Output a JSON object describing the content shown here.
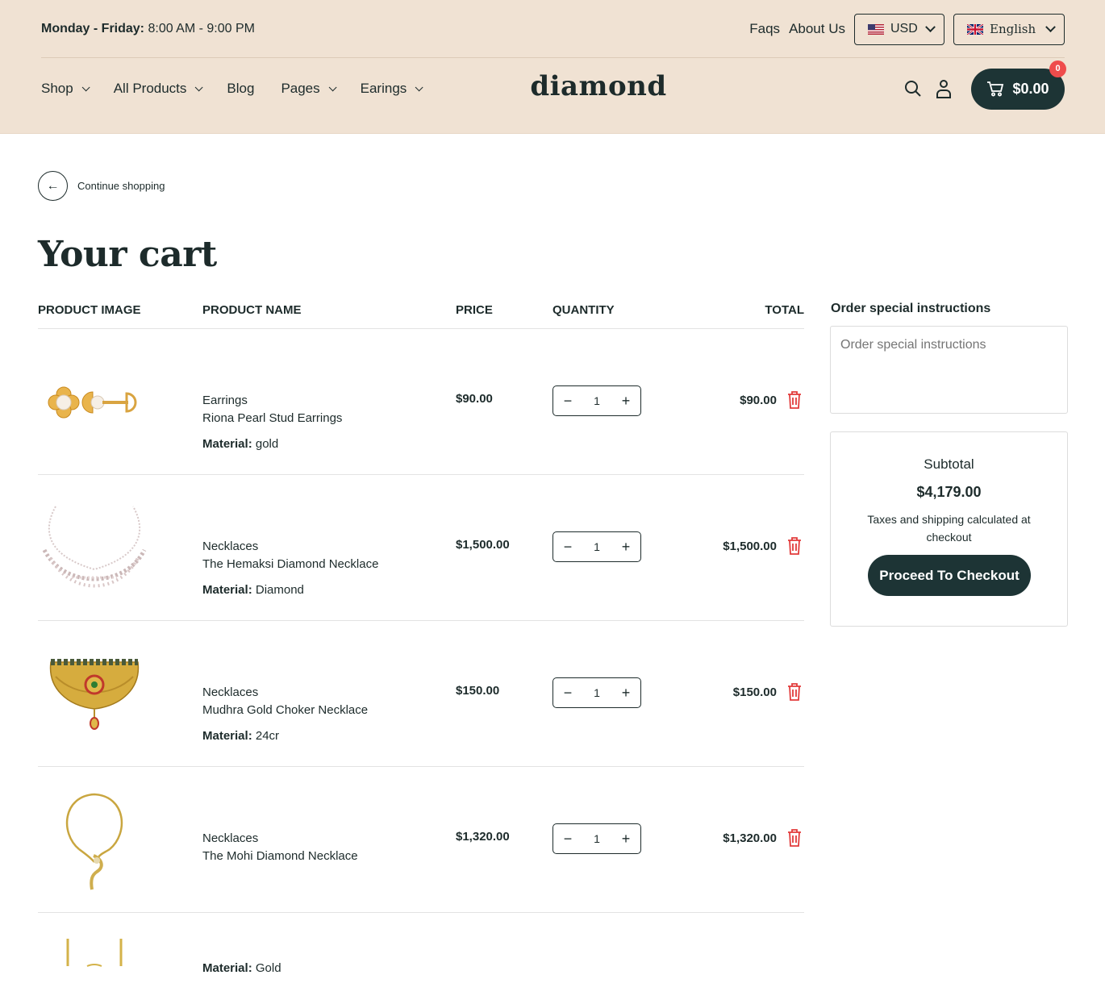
{
  "header": {
    "hours_label": "Monday - Friday:",
    "hours_value": "8:00 AM - 9:00 PM",
    "links": {
      "faqs": "Faqs",
      "about": "About Us"
    },
    "currency": "USD",
    "language": "English",
    "nav": [
      "Shop",
      "All Products",
      "Blog",
      "Pages",
      "Earings"
    ],
    "logo": "diamond",
    "cart_total": "$0.00",
    "cart_count": "0"
  },
  "content": {
    "continue_label": "Continue shopping",
    "title": "Your cart",
    "columns": {
      "image": "PRODUCT IMAGE",
      "name": "PRODUCT NAME",
      "price": "PRICE",
      "quantity": "QUANTITY",
      "total": "TOTAL"
    },
    "items": [
      {
        "category": "Earrings",
        "name": "Riona Pearl Stud Earrings",
        "material_label": "Material:",
        "material": "gold",
        "price": "$90.00",
        "qty": "1",
        "total": "$90.00",
        "image_icon": "pearl-earrings-image"
      },
      {
        "category": "Necklaces",
        "name": "The Hemaksi Diamond Necklace",
        "material_label": "Material:",
        "material": "Diamond",
        "price": "$1,500.00",
        "qty": "1",
        "total": "$1,500.00",
        "image_icon": "diamond-necklace-image"
      },
      {
        "category": "Necklaces",
        "name": "Mudhra Gold Choker Necklace",
        "material_label": "Material:",
        "material": "24cr",
        "price": "$150.00",
        "qty": "1",
        "total": "$150.00",
        "image_icon": "gold-choker-image"
      },
      {
        "category": "Necklaces",
        "name": "The Mohi Diamond Necklace",
        "material_label": "",
        "material": "",
        "price": "$1,320.00",
        "qty": "1",
        "total": "$1,320.00",
        "image_icon": "gold-pendant-necklace-image"
      },
      {
        "category": "",
        "name": "",
        "material_label": "Material:",
        "material": "Gold",
        "price": "",
        "qty": "",
        "total": "",
        "image_icon": "gold-chain-image"
      }
    ]
  },
  "sidebar": {
    "notes_title": "Order special instructions",
    "notes_placeholder": "Order special instructions",
    "subtotal_label": "Subtotal",
    "subtotal_value": "$4,179.00",
    "tax_note": "Taxes and shipping calculated at checkout",
    "checkout_label": "Proceed To Checkout"
  },
  "colors": {
    "header_bg": "#f0e2d3",
    "primary": "#1d3435",
    "badge": "#ef4c4c",
    "delete": "#e23b3b"
  }
}
